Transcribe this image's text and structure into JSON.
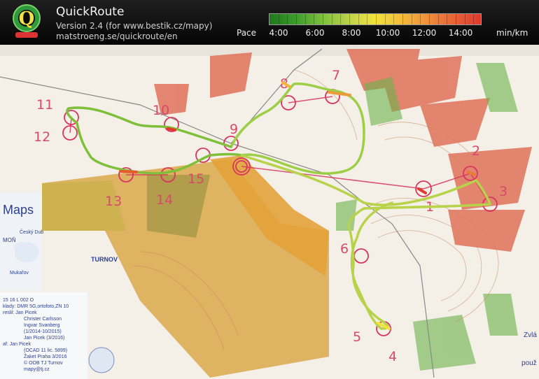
{
  "header": {
    "app_title": "QuickRoute",
    "version_text": "Version 2.4  (for www.bestik.cz/mapy)",
    "url_text": "matstroeng.se/quickroute/en",
    "pace_label": "Pace",
    "pace_ticks": [
      "4:00",
      "6:00",
      "8:00",
      "10:00",
      "12:00",
      "14:00"
    ],
    "unit_label": "min/km",
    "pace_colors": {
      "fast": "#1f7a1a",
      "mid": "#f2e23a",
      "slow": "#e0392e"
    }
  },
  "map": {
    "controls": [
      "1",
      "2",
      "3",
      "4",
      "5",
      "6",
      "7",
      "8",
      "9",
      "10",
      "11",
      "12",
      "13",
      "14",
      "15"
    ],
    "labels": {
      "maps_logo": "Maps",
      "cesky_dub": "Český Dub",
      "mon": "MOŇ",
      "mukarov": "Mukařov",
      "club": "TURNOV",
      "zvla": "Zvlá",
      "pouz": "použ"
    },
    "info_box": [
      "15   16 L 002 O",
      "klady:  DMR 5G,ortofoto,ZN 10",
      "reslil:  Jan Picek",
      "Christer Carlsson",
      "Ingvar Svanberg",
      "(1/2014-10/2015)",
      "Jan Picek (3/2016)",
      "af:  Jan Picek",
      "(OCAD 11 lic. 5899)",
      "Žaket Praha 3/2016",
      "© OOB TJ Turnov",
      "mapy@tj.cz"
    ]
  }
}
